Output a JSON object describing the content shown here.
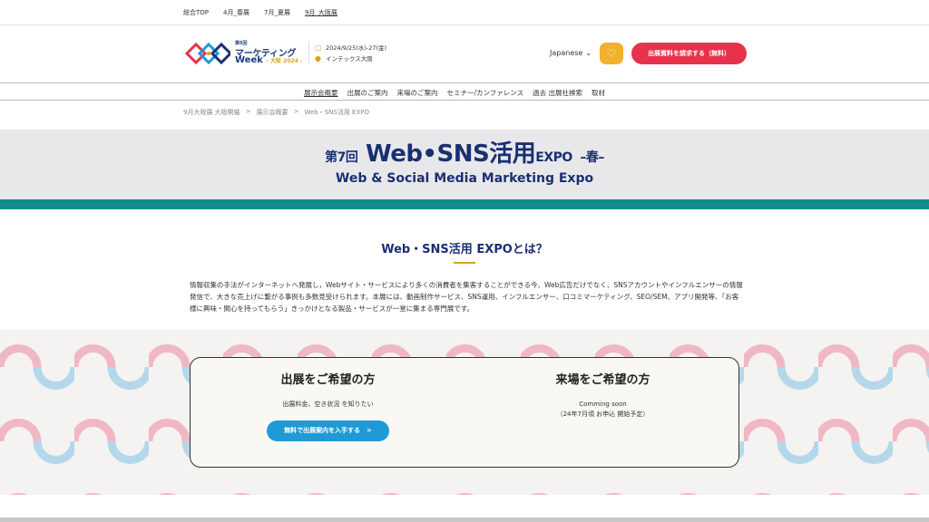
{
  "toplinks": [
    "総合TOP",
    "4月_春展",
    "7月_夏展",
    "9月_大阪展"
  ],
  "logo": {
    "edition": "第5回",
    "name": "マーケティング",
    "week": "Week",
    "region": "- 大阪 2024 -"
  },
  "event": {
    "date": "2024/9/25(水)-27(金)",
    "venue": "インテックス大阪"
  },
  "header": {
    "language": "Japanese",
    "favorite_icon": "heart-icon",
    "cta_label": "出展資料を請求する（無料）"
  },
  "nav": [
    "展示会概要",
    "出展のご案内",
    "来場のご案内",
    "セミナー/カンファレンス",
    "過去 出展社検索",
    "取材"
  ],
  "breadcrumb": [
    "9月大阪展 大阪開催",
    ">",
    "展示会概要",
    ">",
    "Web・SNS活用 EXPO"
  ],
  "hero": {
    "edition": "第7回",
    "title": "Web•SNS活用",
    "expo": "EXPO",
    "season": "–春–",
    "subtitle": "Web & Social Media Marketing Expo"
  },
  "about": {
    "title": "Web・SNS活用 EXPOとは？",
    "text": "情報収集の手法がインターネットへ発展し，Webサイト・サービスにより多くの消費者を集客することができる今、Web広告だけでなく、SNSアカウントやインフルエンサーの情報発信で、大きな売上げに繋がる事例も多数見受けられます。本展には、動画制作サービス、SNS運用、インフルエンサー、口コミマーケティング、SEO/SEM、アプリ開発等、「お客様に興味・関心を持ってもらう」きっかけとなる製品・サービスが一堂に集まる専門展です。"
  },
  "exhibit": {
    "title": "出展をご希望の方",
    "desc": "出展料金、空き状況 を知りたい",
    "button": "無料で出展案内を入手する　>"
  },
  "visit": {
    "title": "来場をご希望の方",
    "line1": "Comming soon",
    "line2": "（24年7月頃 お申込 開始予定）"
  },
  "colors": {
    "navy": "#1a2f73",
    "teal": "#138c8e",
    "cta_red": "#e6334b",
    "button_blue": "#1f9ad6",
    "favorite_yellow": "#f2b02c"
  }
}
